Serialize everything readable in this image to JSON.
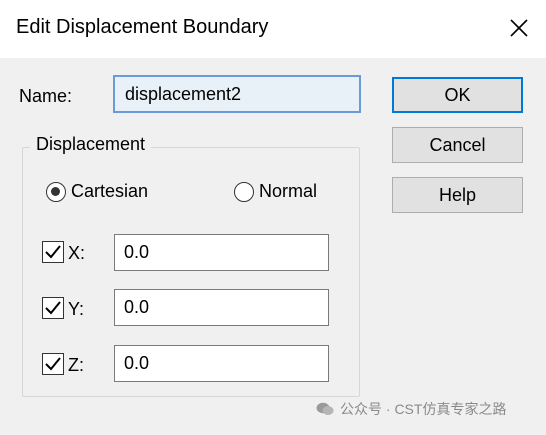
{
  "window": {
    "title": "Edit Displacement Boundary",
    "close_icon": "close-icon"
  },
  "name": {
    "label": "Name:",
    "value": "displacement2"
  },
  "buttons": {
    "ok": "OK",
    "cancel": "Cancel",
    "help": "Help"
  },
  "displacement": {
    "legend": "Displacement",
    "cartesian_label": "Cartesian",
    "normal_label": "Normal",
    "selected": "Cartesian"
  },
  "coordinates": [
    {
      "label": "X:",
      "checked": true,
      "value": "0.0"
    },
    {
      "label": "Y:",
      "checked": true,
      "value": "0.0"
    },
    {
      "label": "Z:",
      "checked": true,
      "value": "0.0"
    }
  ],
  "watermark": {
    "text": "公众号 · CST仿真专家之路"
  },
  "colors": {
    "accent": "#0078d7",
    "focus_border": "#6a9bd8"
  }
}
